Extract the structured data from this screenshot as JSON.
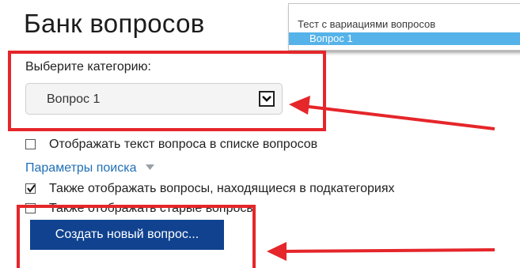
{
  "page_title": "Банк вопросов",
  "category_popup": {
    "options": [
      "Тест с вариациями вопросов",
      "Вопрос 1"
    ],
    "selected_index": 1
  },
  "category_select": {
    "label": "Выберите категорию:",
    "value": "Вопрос 1",
    "arrow_icon": "chevron-down-icon"
  },
  "options": {
    "show_question_text": {
      "label": "Отображать текст вопроса в списке вопросов",
      "checked": false
    },
    "search_params": {
      "label": "Параметры поиска",
      "icon": "caret-down-icon"
    },
    "show_subcategories": {
      "label": "Также отображать вопросы, находящиеся в подкатегориях",
      "checked": true
    },
    "show_old": {
      "label": "Также отображать старые вопросы",
      "checked": false
    }
  },
  "create_button": {
    "label": "Создать новый вопрос..."
  },
  "colors": {
    "button_bg": "#10428f",
    "link": "#1f6fb5",
    "popup_selected": "#55b3e9",
    "annotation": "#e5262a"
  }
}
